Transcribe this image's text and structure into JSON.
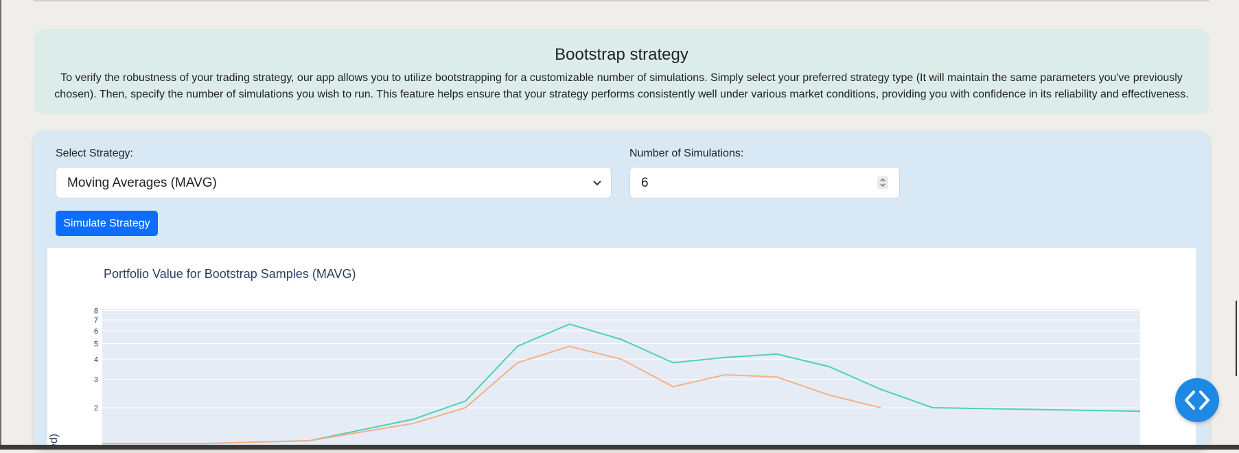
{
  "intro": {
    "title": "Bootstrap strategy",
    "description": "To verify the robustness of your trading strategy, our app allows you to utilize bootstrapping for a customizable number of simulations. Simply select your preferred strategy type (It will maintain the same parameters you've previously chosen). Then, specify the number of simulations you wish to run. This feature helps ensure that your strategy performs consistently well under various market conditions, providing you with confidence in its reliability and effectiveness."
  },
  "form": {
    "strategy_label": "Select Strategy:",
    "strategy_value": "Moving Averages (MAVG)",
    "simulations_label": "Number of Simulations:",
    "simulations_value": "6",
    "submit_label": "Simulate Strategy"
  },
  "icons": {
    "dropdown": "chevron-down-icon",
    "spinner": "stepper-icon",
    "fab": "code-brackets-icon"
  },
  "colors": {
    "primary_button": "#0d6efd",
    "intro_bg": "#dcece8",
    "panel_bg": "#d9e8f5",
    "plot_bg": "#e5ecf6",
    "series_green": "#4fd1b0",
    "series_orange": "#f4b087"
  },
  "chart_data": {
    "type": "line",
    "title": "Portfolio Value for Bootstrap Samples (MAVG)",
    "ylabel_visible_fragment": "ed)",
    "yscale": "log",
    "ytick_labels": [
      "2",
      "3",
      "4",
      "5",
      "6",
      "7",
      "8"
    ],
    "ylim": [
      2,
      8
    ],
    "series": [
      {
        "color": "#4fd1b0",
        "x": [
          0,
          10,
          20,
          30,
          35,
          40,
          45,
          50,
          55,
          60,
          65,
          70,
          75,
          80,
          90,
          100
        ],
        "y": [
          1.2,
          1.2,
          1.25,
          1.7,
          2.2,
          4.8,
          6.6,
          5.3,
          3.8,
          4.1,
          4.3,
          3.6,
          2.6,
          2.0,
          1.95,
          1.9
        ]
      },
      {
        "color": "#f4b087",
        "x": [
          0,
          10,
          20,
          30,
          35,
          40,
          45,
          50,
          55,
          60,
          65,
          70,
          75
        ],
        "y": [
          1.2,
          1.2,
          1.25,
          1.6,
          2.0,
          3.8,
          4.8,
          4.0,
          2.7,
          3.2,
          3.1,
          2.4,
          2.0
        ]
      }
    ]
  }
}
